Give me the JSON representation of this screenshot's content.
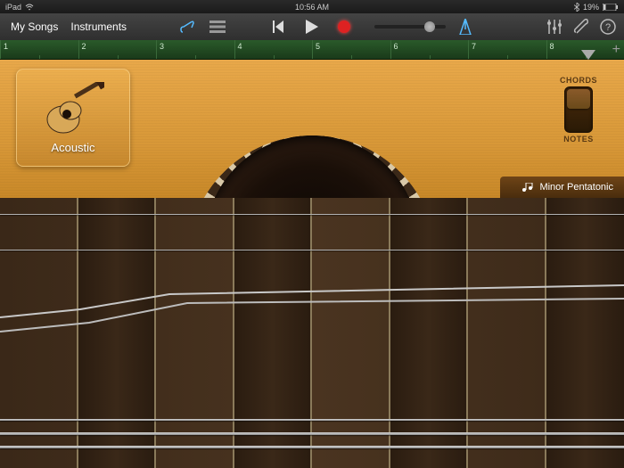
{
  "status": {
    "device": "iPad",
    "time": "10:56 AM",
    "bluetooth": "bluetooth-icon",
    "battery_pct": "19%"
  },
  "toolbar": {
    "my_songs": "My Songs",
    "instruments": "Instruments",
    "view_instrument": "instrument-view-icon",
    "view_tracks": "tracks-view-icon",
    "rewind": "rewind-icon",
    "play": "play-icon",
    "record": "record-icon",
    "metronome": "metronome-icon",
    "mixer": "mixer-icon",
    "settings": "settings-icon",
    "help": "help-icon"
  },
  "ruler": {
    "bars": [
      "1",
      "2",
      "3",
      "4",
      "5",
      "6",
      "7",
      "8"
    ],
    "add": "+"
  },
  "instrument": {
    "name": "Acoustic"
  },
  "mode": {
    "chords": "CHORDS",
    "notes": "NOTES",
    "state": "chords"
  },
  "scale": {
    "label": "Minor Pentatonic"
  },
  "fretboard": {
    "columns": 8,
    "strings": 6
  }
}
